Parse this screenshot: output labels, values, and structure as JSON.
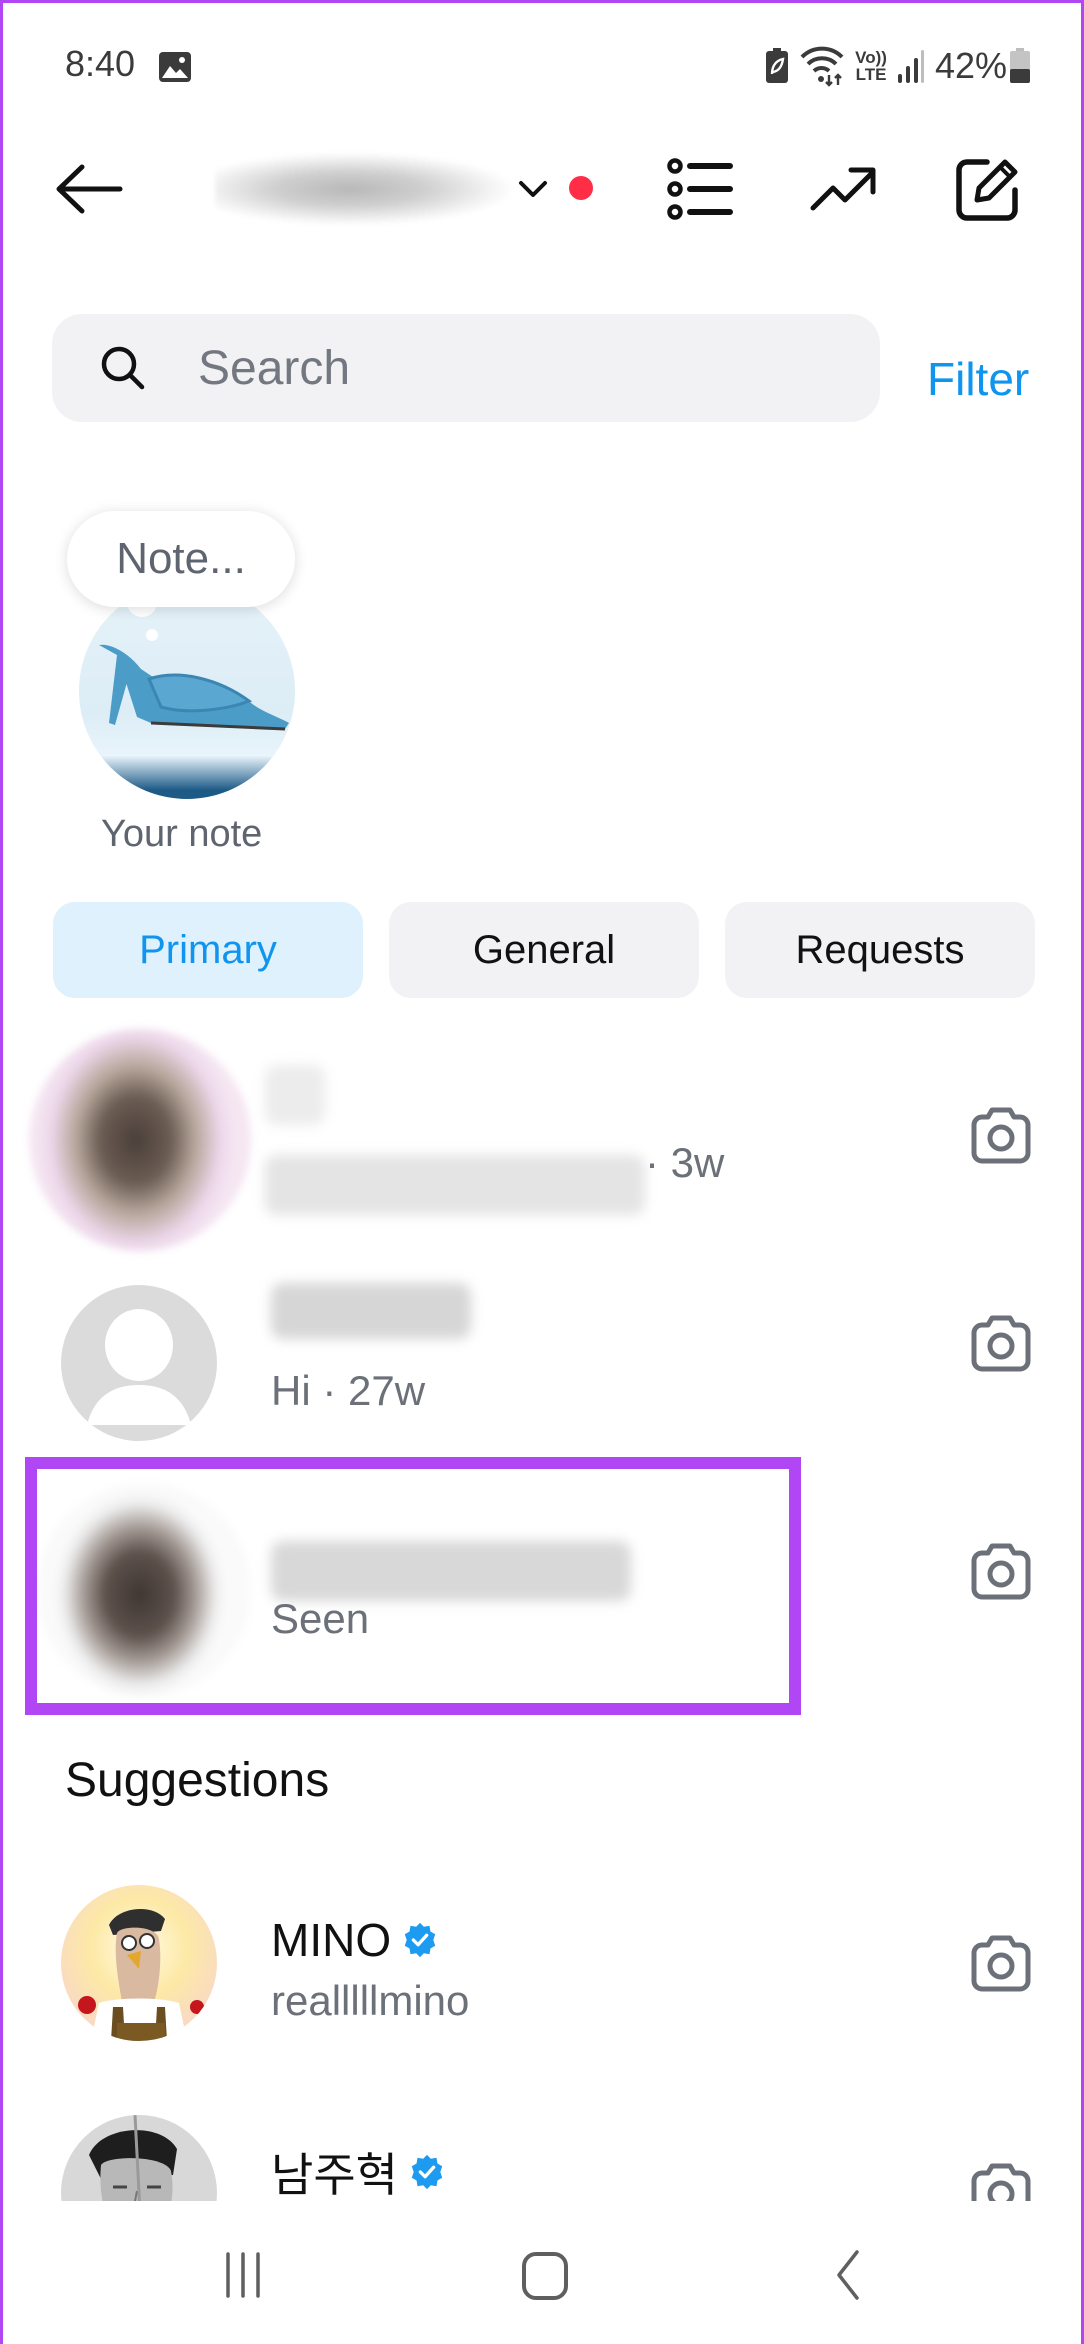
{
  "status_bar": {
    "time": "8:40",
    "battery_percent": "42%",
    "network_label_top": "Vo))",
    "network_label_bottom": "LTE",
    "icons": [
      "gallery-icon",
      "battery-saver-icon",
      "wifi-icon",
      "volte-icon",
      "signal-icon",
      "battery-icon"
    ]
  },
  "header": {
    "account_name": "username (blurred)",
    "has_notification_dot": true,
    "notification_dot_color": "#ff2d46",
    "icons": [
      "back-arrow-icon",
      "chevron-down-icon",
      "list-icon",
      "trending-icon",
      "compose-icon"
    ]
  },
  "search": {
    "placeholder": "Search",
    "value": "",
    "filter_label": "Filter"
  },
  "note": {
    "bubble_text": "Note...",
    "label": "Your note"
  },
  "tabs": [
    {
      "label": "Primary",
      "active": true
    },
    {
      "label": "General",
      "active": false
    },
    {
      "label": "Requests",
      "active": false
    }
  ],
  "conversations": [
    {
      "name": "(blurred)",
      "preview": "(blurred)",
      "time": "· 3w",
      "highlighted": false
    },
    {
      "name": "(blurred)",
      "preview": "Hi · 27w",
      "time": "",
      "highlighted": false
    },
    {
      "name": "(blurred)",
      "preview": "Seen",
      "time": "",
      "highlighted": true
    }
  ],
  "suggestions": {
    "title": "Suggestions",
    "items": [
      {
        "name": "MINO",
        "username": "realllllmino",
        "verified": true
      },
      {
        "name": "남주혁",
        "username": "",
        "verified": true
      }
    ]
  },
  "colors": {
    "accent": "#0f95f0",
    "highlight": "#b146f5",
    "tab_active_bg": "#dff1fd",
    "tab_bg": "#f2f2f5",
    "secondary_text": "#6b7079",
    "verified": "#1d9bf0"
  },
  "nav_bar": {
    "buttons": [
      "recents-icon",
      "home-icon",
      "back-icon"
    ]
  }
}
